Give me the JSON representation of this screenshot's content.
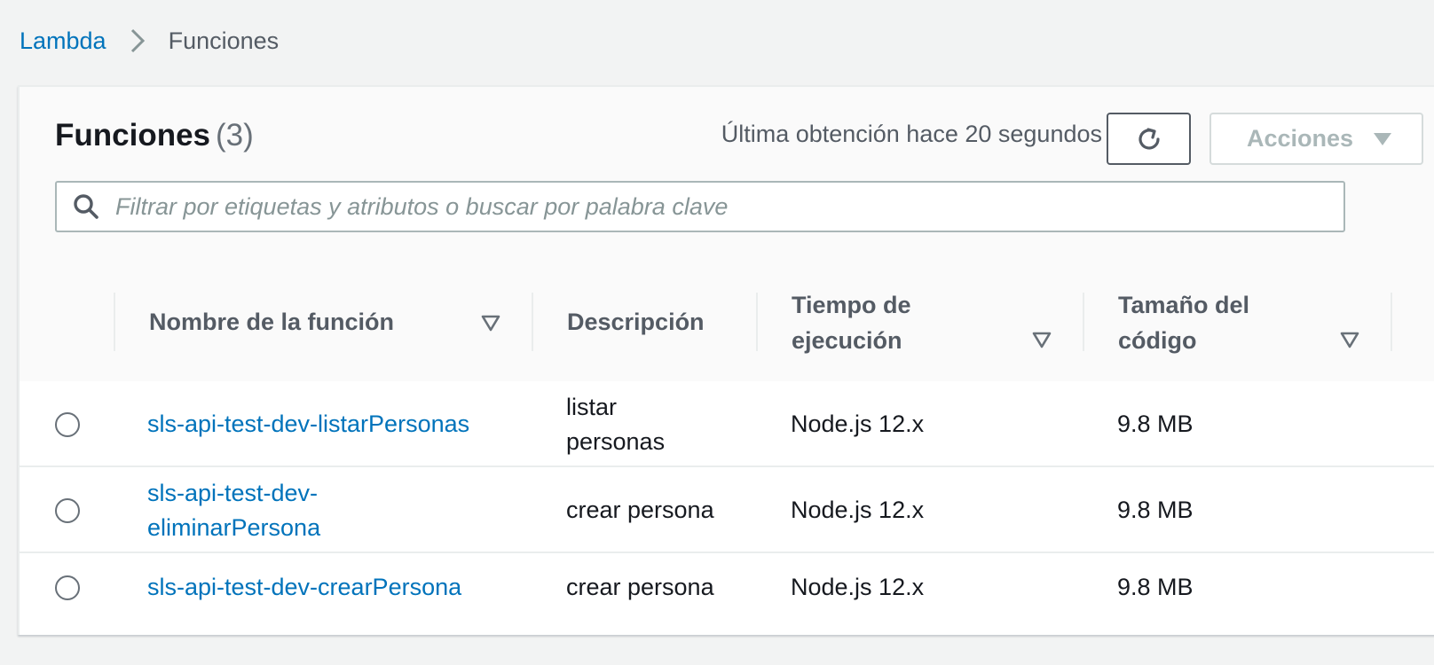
{
  "breadcrumb": {
    "root": "Lambda",
    "current": "Funciones"
  },
  "panel": {
    "title": "Funciones",
    "count": "(3)",
    "last_fetch": "Última obtención hace 20 segundos",
    "actions_label": "Acciones",
    "search_placeholder": "Filtrar por etiquetas y atributos o buscar por palabra clave"
  },
  "columns": {
    "name": "Nombre de la función",
    "description": "Descripción",
    "runtime_line1": "Tiempo de",
    "runtime_line2": "ejecución",
    "size_line1": "Tamaño del",
    "size_line2": "código"
  },
  "rows": [
    {
      "name_line1": "sls-api-test-dev-listarPersonas",
      "name_line2": "",
      "desc_line1": "listar",
      "desc_line2": "personas",
      "runtime": "Node.js 12.x",
      "size": "9.8 MB"
    },
    {
      "name_line1": "sls-api-test-dev-",
      "name_line2": "eliminarPersona",
      "desc_line1": "crear persona",
      "desc_line2": "",
      "runtime": "Node.js 12.x",
      "size": "9.8 MB"
    },
    {
      "name_line1": "sls-api-test-dev-crearPersona",
      "name_line2": "",
      "desc_line1": "crear persona",
      "desc_line2": "",
      "runtime": "Node.js 12.x",
      "size": "9.8 MB"
    }
  ],
  "icons": {
    "breadcrumb_separator": "chevron-right-icon",
    "refresh": "refresh-icon",
    "actions_caret": "caret-down-icon",
    "search": "search-icon",
    "sort": "sort-caret-icon"
  },
  "colors": {
    "link": "#0073bb",
    "text": "#16191f",
    "muted": "#545b64",
    "disabled": "#aab7b8",
    "background": "#f2f3f3"
  }
}
